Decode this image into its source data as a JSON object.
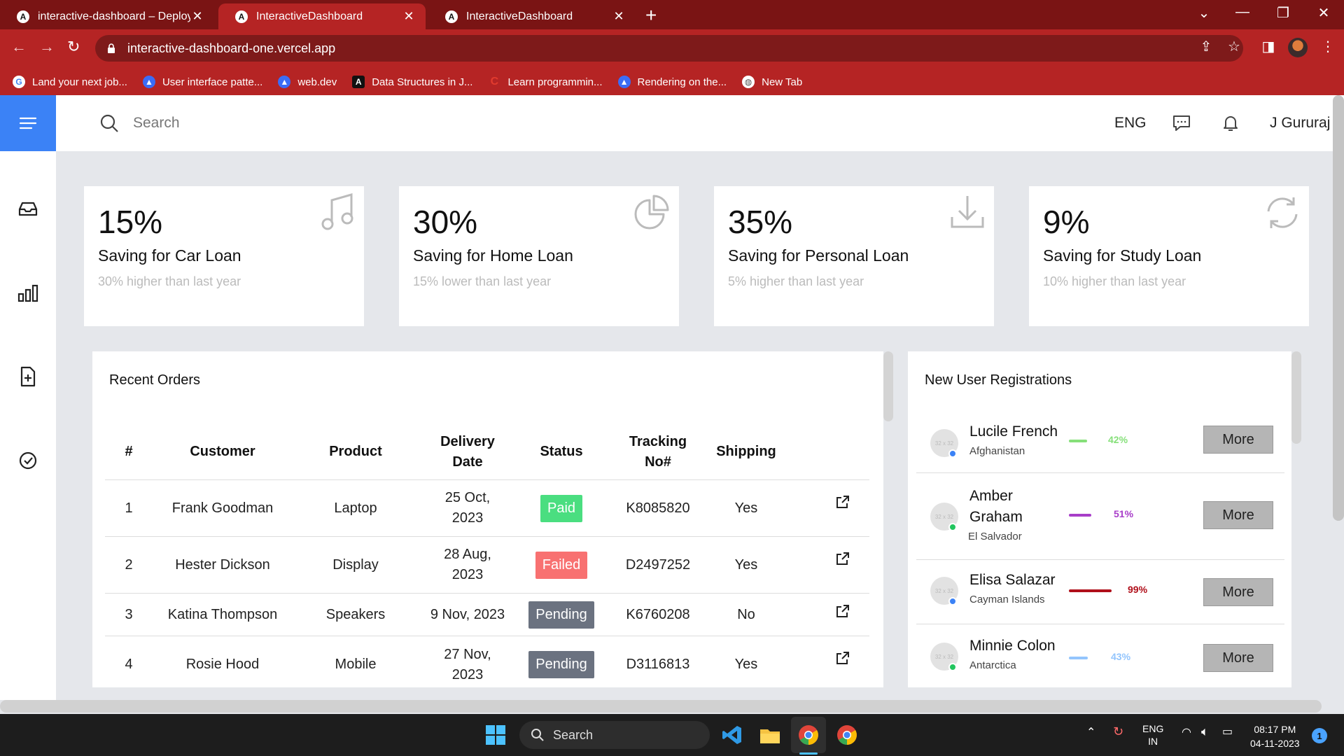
{
  "browser": {
    "tabs": [
      {
        "title": "interactive-dashboard – Deployment",
        "fav": "A"
      },
      {
        "title": "InteractiveDashboard",
        "fav": "A"
      },
      {
        "title": "InteractiveDashboard",
        "fav": "A"
      }
    ],
    "active_tab": 1,
    "url": "interactive-dashboard-one.vercel.app",
    "bookmarks": [
      {
        "label": "Land your next job...",
        "icon": "google-icon",
        "color": "#ffffff"
      },
      {
        "label": "User interface patte...",
        "icon": "bookmark-icon",
        "color": "#3b6cf6"
      },
      {
        "label": "web.dev",
        "icon": "bookmark-icon",
        "color": "#3b6cf6"
      },
      {
        "label": "Data Structures in J...",
        "icon": "angular-icon",
        "color": "#111111"
      },
      {
        "label": "Learn programmin...",
        "icon": "c-icon",
        "color": "#e23b2e"
      },
      {
        "label": "Rendering on the...",
        "icon": "bookmark-icon",
        "color": "#3b6cf6"
      },
      {
        "label": "New Tab",
        "icon": "globe-icon",
        "color": "#ffffff"
      }
    ]
  },
  "topbar": {
    "search_placeholder": "Search",
    "language": "ENG",
    "user_name": "J Gururaj"
  },
  "cards": [
    {
      "percent": "15%",
      "label": "Saving for Car Loan",
      "sub": "30% higher than last year",
      "icon": "music-icon"
    },
    {
      "percent": "30%",
      "label": "Saving for Home Loan",
      "sub": "15% lower than last year",
      "icon": "pie-chart-icon"
    },
    {
      "percent": "35%",
      "label": "Saving for Personal Loan",
      "sub": "5% higher than last year",
      "icon": "download-icon"
    },
    {
      "percent": "9%",
      "label": "Saving for Study Loan",
      "sub": "10% higher than last year",
      "icon": "refresh-icon"
    }
  ],
  "orders": {
    "title": "Recent Orders",
    "headers": [
      "#",
      "Customer",
      "Product",
      "Delivery Date",
      "Status",
      "Tracking No#",
      "Shipping"
    ],
    "rows": [
      {
        "num": "1",
        "customer": "Frank Goodman",
        "product": "Laptop",
        "date": "25 Oct, 2023",
        "status": "Paid",
        "tracking": "K8085820",
        "shipping": "Yes"
      },
      {
        "num": "2",
        "customer": "Hester Dickson",
        "product": "Display",
        "date": "28 Aug, 2023",
        "status": "Failed",
        "tracking": "D2497252",
        "shipping": "Yes"
      },
      {
        "num": "3",
        "customer": "Katina Thompson",
        "product": "Speakers",
        "date": "9 Nov, 2023",
        "status": "Pending",
        "tracking": "K6760208",
        "shipping": "No"
      },
      {
        "num": "4",
        "customer": "Rosie Hood",
        "product": "Mobile",
        "date": "27 Nov, 2023",
        "status": "Pending",
        "tracking": "D3116813",
        "shipping": "Yes"
      }
    ],
    "status_colors": {
      "Paid": "#4ade80",
      "Failed": "#f87171",
      "Pending": "#6b7280"
    }
  },
  "registrations": {
    "title": "New User Registrations",
    "avatar_placeholder": "32 x 32",
    "more_label": "More",
    "users": [
      {
        "name": "Lucile French",
        "country": "Afghanistan",
        "percent": "42%",
        "progress": 0.42,
        "color": "#86e07a",
        "dot": "#3b82f6"
      },
      {
        "name": "Amber Graham",
        "country": "El Salvador",
        "percent": "51%",
        "progress": 0.51,
        "color": "#a83ec9",
        "dot": "#22c55e"
      },
      {
        "name": "Elisa Salazar",
        "country": "Cayman Islands",
        "percent": "99%",
        "progress": 0.99,
        "color": "#b00f1a",
        "dot": "#3b82f6"
      },
      {
        "name": "Minnie Colon",
        "country": "Antarctica",
        "percent": "43%",
        "progress": 0.43,
        "color": "#93c5fd",
        "dot": "#22c55e"
      }
    ]
  },
  "taskbar": {
    "search_label": "Search",
    "lang_line1": "ENG",
    "lang_line2": "IN",
    "time": "08:17 PM",
    "date": "04-11-2023",
    "notifications": "1"
  },
  "colors": {
    "brand": "#3b82f6",
    "browser": "#b52424"
  }
}
